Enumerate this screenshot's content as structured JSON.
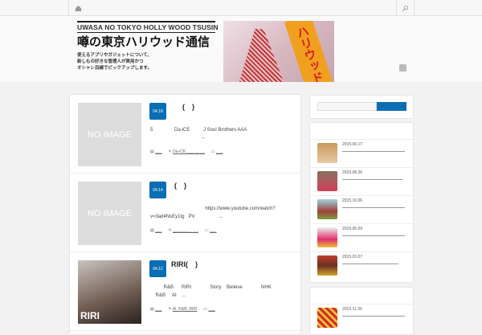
{
  "header": {
    "logo_en": "UWASA NO TOKYO HOLLY WOOD TSUSIN",
    "logo_jp": "噂の東京ハリウッド通信",
    "logo_sub": [
      "使えるアプリやガジェットについて、",
      "新しもの好きな管理人が実用かつ",
      "オシャレ目線でピックアップします。"
    ],
    "banner_text": "ハリウッド"
  },
  "icons": {
    "home": "home-icon",
    "search": "search-icon",
    "rss": "rss-icon"
  },
  "posts": [
    {
      "date": "04.18",
      "title": "(　)",
      "thumb": "NO IMAGE",
      "lines": [
        "5                Da-iCE          J Soul Brothers AAA",
        "                                      ..."
      ],
      "meta": [
        "___",
        "Da-iCE ___ __ __",
        "___"
      ]
    },
    {
      "date": "04.14",
      "title": "(　)",
      "thumb": "NO IMAGE",
      "lines": [
        "                                         https://www.youtube.com/watch?",
        "v=3ad4NsEy1tg   PV                  ..."
      ],
      "meta": [
        "___",
        "_______ _ _ _",
        "___"
      ]
    },
    {
      "date": "04.12",
      "title": "RIRI(　)",
      "thumb": "RIRI",
      "lines": [
        "          R&B      RIRI              Story    Believe              NHK",
        "    R&B     AI    ..."
      ],
      "meta": [
        "___",
        "AI, R&B, RIRI",
        "___"
      ]
    }
  ],
  "sidebar": {
    "search_button": "",
    "popular": [
      {
        "date": "2015.06.17"
      },
      {
        "date": "2015.08.26"
      },
      {
        "date": "2015.10.06"
      },
      {
        "date": "2015.05.09"
      },
      {
        "date": "2015.03.07"
      }
    ],
    "recent": [
      {
        "date": "2015.11.30"
      }
    ]
  },
  "colors": {
    "accent": "#0a6eb4"
  }
}
